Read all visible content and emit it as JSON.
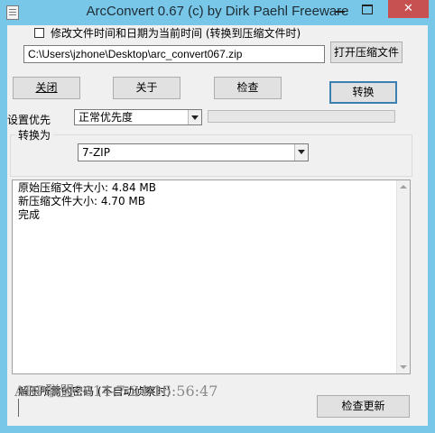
{
  "window": {
    "title": "ArcConvert 0.67 (c) by Dirk Paehl Freeware",
    "close_label": "✕",
    "frame_color": "#79c7e8",
    "close_color": "#c75050"
  },
  "options": {
    "modify_time_label": "修改文件时间和日期为当前时间 (转换到压缩文件时)",
    "modify_time_checked": false
  },
  "file": {
    "path": "C:\\Users\\jzhone\\Desktop\\arc_convert067.zip",
    "open_button": "打开压缩文件"
  },
  "buttons": {
    "close": "关闭",
    "about": "关于",
    "check": "检查",
    "convert": "转换",
    "check_update": "检查更新"
  },
  "priority": {
    "label": "设置优先",
    "selected": "正常优先度"
  },
  "progress": {
    "value": 0,
    "color": "#06b025"
  },
  "convert_to": {
    "label": "转换为",
    "selected": "7-ZIP"
  },
  "log": {
    "lines": [
      "原始压缩文件大小: 4.84 MB",
      "新压缩文件大小: 4.70 MB",
      "完成"
    ]
  },
  "password": {
    "label": "解压所需的密码 (不自动侦察时)"
  },
  "watermark": "ARP联盟2014-7-24 16:56:47"
}
